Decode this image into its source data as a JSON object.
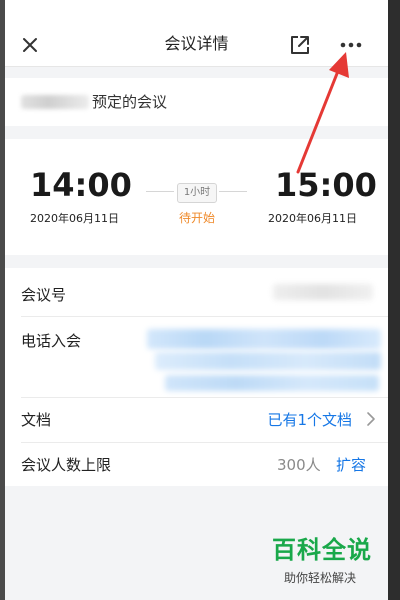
{
  "nav": {
    "title": "会议详情"
  },
  "organizer": {
    "suffix": "预定的会议"
  },
  "schedule": {
    "start_time": "14:00",
    "start_date": "2020年06月11日",
    "end_time": "15:00",
    "end_date": "2020年06月11日",
    "duration": "1小时",
    "status": "待开始"
  },
  "details": {
    "meeting_id_label": "会议号",
    "phone_join_label": "电话入会",
    "document_label": "文档",
    "document_value": "已有1个文档",
    "capacity_label": "会议人数上限",
    "capacity_value": "300人",
    "expand_label": "扩容"
  },
  "watermark": {
    "title": "百科全说",
    "subtitle": "助你轻松解决"
  },
  "colors": {
    "accent_blue": "#1677e6",
    "status_orange": "#ef8a2b",
    "annotation_red": "#e53935",
    "watermark_green": "#19a84a"
  },
  "icons": {
    "close": "close-icon",
    "open_external": "open-external-icon",
    "more": "more-icon",
    "chevron": "chevron-right-icon"
  }
}
